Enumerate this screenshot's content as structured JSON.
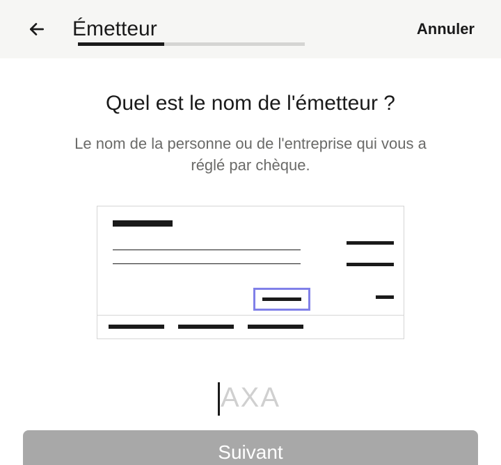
{
  "header": {
    "title": "Émetteur",
    "cancel": "Annuler"
  },
  "content": {
    "question": "Quel est le nom de l'émetteur ?",
    "subtitle": "Le nom de la personne ou de l'entreprise qui vous a réglé par chèque."
  },
  "input": {
    "placeholder": "AXA"
  },
  "footer": {
    "next": "Suivant"
  }
}
